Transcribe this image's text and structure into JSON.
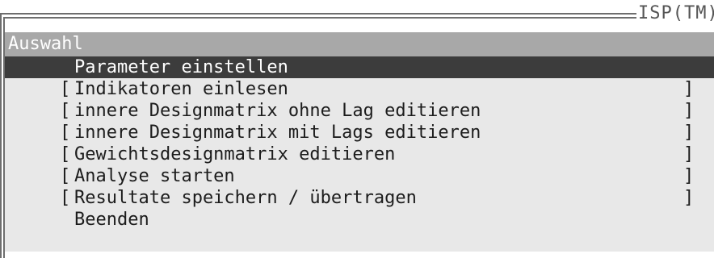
{
  "window": {
    "brand": "ISP(TM)"
  },
  "menu": {
    "title": "Auswahl",
    "items": [
      {
        "label": "Parameter einstellen",
        "selected": true,
        "bracketed": false
      },
      {
        "label": "Indikatoren einlesen",
        "selected": false,
        "bracketed": true
      },
      {
        "label": "innere Designmatrix ohne Lag editieren",
        "selected": false,
        "bracketed": true
      },
      {
        "label": "innere Designmatrix mit Lags editieren",
        "selected": false,
        "bracketed": true
      },
      {
        "label": "Gewichtsdesignmatrix editieren",
        "selected": false,
        "bracketed": true
      },
      {
        "label": "Analyse starten",
        "selected": false,
        "bracketed": true
      },
      {
        "label": "Resultate speichern / übertragen",
        "selected": false,
        "bracketed": true
      },
      {
        "label": "Beenden",
        "selected": false,
        "bracketed": false
      }
    ],
    "bracket_open": "[",
    "bracket_close": "]"
  },
  "colors": {
    "selected_bg": "#3c3c3c",
    "title_bg": "#a8a8a8",
    "panel_bg": "#e8e8e8"
  }
}
